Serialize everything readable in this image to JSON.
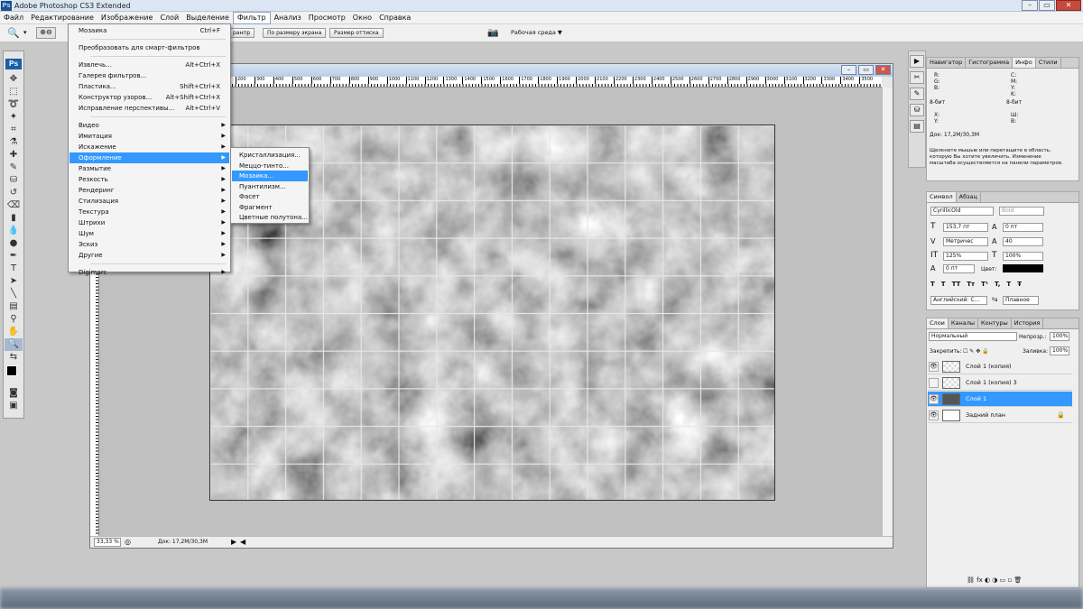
{
  "app": {
    "title": "Adobe Photoshop CS3 Extended",
    "logo": "Ps"
  },
  "menubar": [
    "Файл",
    "Редактирование",
    "Изображение",
    "Слой",
    "Выделение",
    "Фильтр",
    "Анализ",
    "Просмотр",
    "Окно",
    "Справка"
  ],
  "menubar_active": "Фильтр",
  "options": {
    "btn1": "ранпр",
    "btn2": "По размеру экрана",
    "btn3": "Размер оттиска",
    "workspace": "Рабочая среда ▼"
  },
  "filter_menu": {
    "top": [
      {
        "label": "Мозаика",
        "shortcut": "Ctrl+F"
      },
      {
        "label": "Преобразовать для смарт-фильтров"
      },
      {
        "label": "Извлечь...",
        "shortcut": "Alt+Ctrl+X"
      },
      {
        "label": "Галерея фильтров..."
      },
      {
        "label": "Пластика...",
        "shortcut": "Shift+Ctrl+X"
      },
      {
        "label": "Конструктор узоров...",
        "shortcut": "Alt+Shift+Ctrl+X"
      },
      {
        "label": "Исправление перспективы...",
        "shortcut": "Alt+Ctrl+V"
      }
    ],
    "groups": [
      "Видео",
      "Имитация",
      "Искажение",
      "Оформление",
      "Размытие",
      "Резкость",
      "Рендеринг",
      "Стилизация",
      "Текстура",
      "Штрихи",
      "Шум",
      "Эскиз",
      "Другие"
    ],
    "highlighted": "Оформление",
    "last": "Digimarc"
  },
  "submenu": {
    "items": [
      "Кристаллизация...",
      "Меццо-тинто...",
      "Мозаика...",
      "Пуантилизм...",
      "Фасет",
      "Фрагмент",
      "Цветные полутона..."
    ],
    "highlighted": "Мозаика..."
  },
  "ruler": [
    "200",
    "300",
    "400",
    "500",
    "600",
    "700",
    "800",
    "900",
    "1000",
    "1100",
    "1200",
    "1300",
    "1400",
    "1500",
    "1600",
    "1700",
    "1800",
    "1900",
    "2000",
    "2100",
    "2200",
    "2300",
    "2400",
    "2500",
    "2600",
    "2700",
    "2800",
    "2900",
    "3000",
    "3100",
    "3200",
    "3300",
    "3400",
    "3500"
  ],
  "status": {
    "zoom": "33,33 %",
    "doc": "Док: 17,2M/30,3M"
  },
  "info_panel": {
    "tabs": [
      "Навигатор",
      "Гистограмма",
      "Инфо",
      "Стили"
    ],
    "active_tab": "Инфо",
    "rgb": "R:\nG:\nB:",
    "cmyk": "C:\nM:\nY:\nK:",
    "bits1": "8-бит",
    "bits2": "8-бит",
    "xy": "X:\nY:",
    "wh": "Ш:\nВ:",
    "doc": "Док: 17,2M/30,3M",
    "hint": "Щелкните мышью или перетащите в область,\nкоторую Вы хотите увеличить. Изменение\nмасштаба осуществляется на панели параметров."
  },
  "char_panel": {
    "tabs": [
      "Символ",
      "Абзац"
    ],
    "font": "CyrillicOld",
    "style": "Bold",
    "size": "153,7 пт",
    "leading": "0 пт",
    "kerning": "Метричес",
    "tracking": "40",
    "vscale": "125%",
    "hscale": "100%",
    "baseline": "0 пт",
    "color_label": "Цвет:",
    "styles": [
      "T",
      "T",
      "TT",
      "Tт",
      "T¹",
      "T,",
      "T",
      "Ŧ"
    ],
    "language": "Английский: С...",
    "aa_icon": "ªa",
    "aa": "Плавное"
  },
  "layers_panel": {
    "tabs": [
      "Слои",
      "Каналы",
      "Контуры",
      "История"
    ],
    "blend": "Нормальный",
    "opacity_label": "Непрозр.:",
    "opacity": "100%",
    "lock_label": "Закрепить:",
    "lock_icons": "☐ ✎ ✥ 🔒",
    "fill_label": "Заливка:",
    "fill": "100%",
    "layers": [
      {
        "name": "Слой 1 (копия)",
        "visible": true
      },
      {
        "name": "Слой 1 (копия) 3",
        "visible": false
      },
      {
        "name": "Слой 1",
        "visible": true,
        "selected": true
      },
      {
        "name": "Задний план",
        "visible": true,
        "locked": true
      }
    ],
    "footer": "⛓ fx ◐ ◑ ▭ ▫ 🗑"
  },
  "colors": {
    "accent": "#3399ff",
    "titlebar": "#dce7f3"
  }
}
